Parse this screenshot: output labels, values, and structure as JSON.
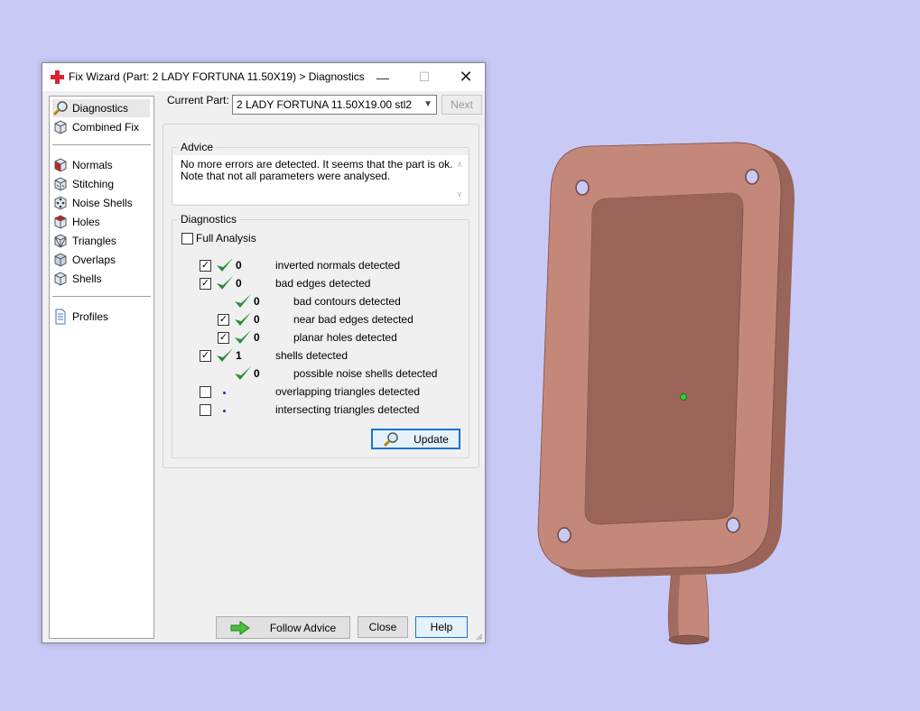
{
  "window": {
    "title": "Fix Wizard (Part: 2 LADY FORTUNA 11.50X19) > Diagnostics",
    "controls": {
      "minimize": "—",
      "maximize": "☐",
      "close": "✕"
    }
  },
  "sidebar": {
    "top_items": [
      {
        "label": "Diagnostics",
        "icon": "magnifier-icon",
        "selected": true
      },
      {
        "label": "Combined Fix",
        "icon": "cube-icon",
        "selected": false
      }
    ],
    "fix_items": [
      {
        "label": "Normals",
        "icon": "normals-cube-icon"
      },
      {
        "label": "Stitching",
        "icon": "stitching-cube-icon"
      },
      {
        "label": "Noise Shells",
        "icon": "noise-shells-icon"
      },
      {
        "label": "Holes",
        "icon": "holes-cube-icon"
      },
      {
        "label": "Triangles",
        "icon": "triangles-cube-icon"
      },
      {
        "label": "Overlaps",
        "icon": "overlaps-cube-icon"
      },
      {
        "label": "Shells",
        "icon": "shells-cube-icon"
      }
    ],
    "bottom_items": [
      {
        "label": "Profiles",
        "icon": "document-icon"
      }
    ]
  },
  "part": {
    "label": "Current Part:",
    "selected": "2 LADY FORTUNA 11.50X19.00 stl2",
    "next_label": "Next"
  },
  "advice": {
    "title": "Advice",
    "line1": "No more errors are detected. It seems that the part is ok.",
    "line2": "Note that not all parameters were analysed."
  },
  "diagnostics": {
    "title": "Diagnostics",
    "full_analysis": {
      "label": "Full Analysis",
      "checked": false
    },
    "rows": [
      {
        "checkbox": true,
        "checked": true,
        "status": "ok",
        "count": "0",
        "label": "inverted normals detected",
        "indent": 0
      },
      {
        "checkbox": true,
        "checked": true,
        "status": "ok",
        "count": "0",
        "label": "bad edges detected",
        "indent": 0
      },
      {
        "checkbox": false,
        "checked": false,
        "status": "ok",
        "count": "0",
        "label": "bad contours detected",
        "indent": 1
      },
      {
        "checkbox": true,
        "checked": true,
        "status": "ok",
        "count": "0",
        "label": "near bad edges detected",
        "indent": 1
      },
      {
        "checkbox": true,
        "checked": true,
        "status": "ok",
        "count": "0",
        "label": "planar holes detected",
        "indent": 1
      },
      {
        "checkbox": true,
        "checked": true,
        "status": "ok",
        "count": "1",
        "label": "shells detected",
        "indent": 0
      },
      {
        "checkbox": false,
        "checked": false,
        "status": "ok",
        "count": "0",
        "label": "possible noise shells detected",
        "indent": 1
      },
      {
        "checkbox": true,
        "checked": false,
        "status": "pending",
        "count": "",
        "label": "overlapping triangles detected",
        "indent": 0
      },
      {
        "checkbox": true,
        "checked": false,
        "status": "pending",
        "count": "",
        "label": "intersecting triangles detected",
        "indent": 0
      }
    ],
    "update_label": "Update"
  },
  "footer": {
    "follow_advice": "Follow Advice",
    "close": "Close",
    "help": "Help"
  },
  "colors": {
    "viewport_bg": "#c9c9f6",
    "part_color": "#c4887a",
    "check_green": "#2e8b3e",
    "accent_blue": "#1a74cc"
  }
}
